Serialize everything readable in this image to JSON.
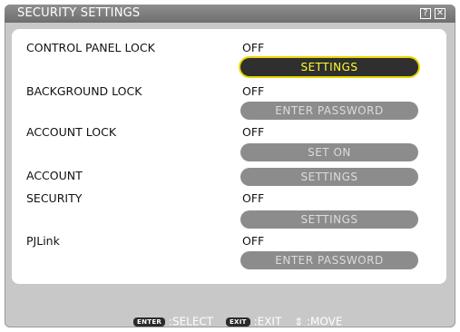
{
  "window": {
    "title": "SECURITY SETTINGS"
  },
  "titlebar_buttons": {
    "help": "?",
    "close": "✕"
  },
  "rows": {
    "control_panel_lock": {
      "label": "CONTROL PANEL LOCK",
      "value": "OFF",
      "button": "SETTINGS"
    },
    "background_lock": {
      "label": "BACKGROUND LOCK",
      "value": "OFF",
      "button": "ENTER PASSWORD"
    },
    "account_lock": {
      "label": "ACCOUNT LOCK",
      "value": "OFF",
      "button": "SET ON"
    },
    "account": {
      "label": "ACCOUNT",
      "button": "SETTINGS"
    },
    "security": {
      "label": "SECURITY",
      "value": "OFF",
      "button": "SETTINGS"
    },
    "pjlink": {
      "label": "PJLink",
      "value": "OFF",
      "button": "ENTER PASSWORD"
    }
  },
  "footer": {
    "enter_key": "ENTER",
    "enter_action": ":SELECT",
    "exit_key": "EXIT",
    "exit_action": ":EXIT",
    "move_icon": "⇕",
    "move_action": ":MOVE"
  },
  "colors": {
    "highlight_text": "#ffff2e",
    "highlight_border": "#e6d600",
    "button_inactive": "#8c8c8c"
  }
}
